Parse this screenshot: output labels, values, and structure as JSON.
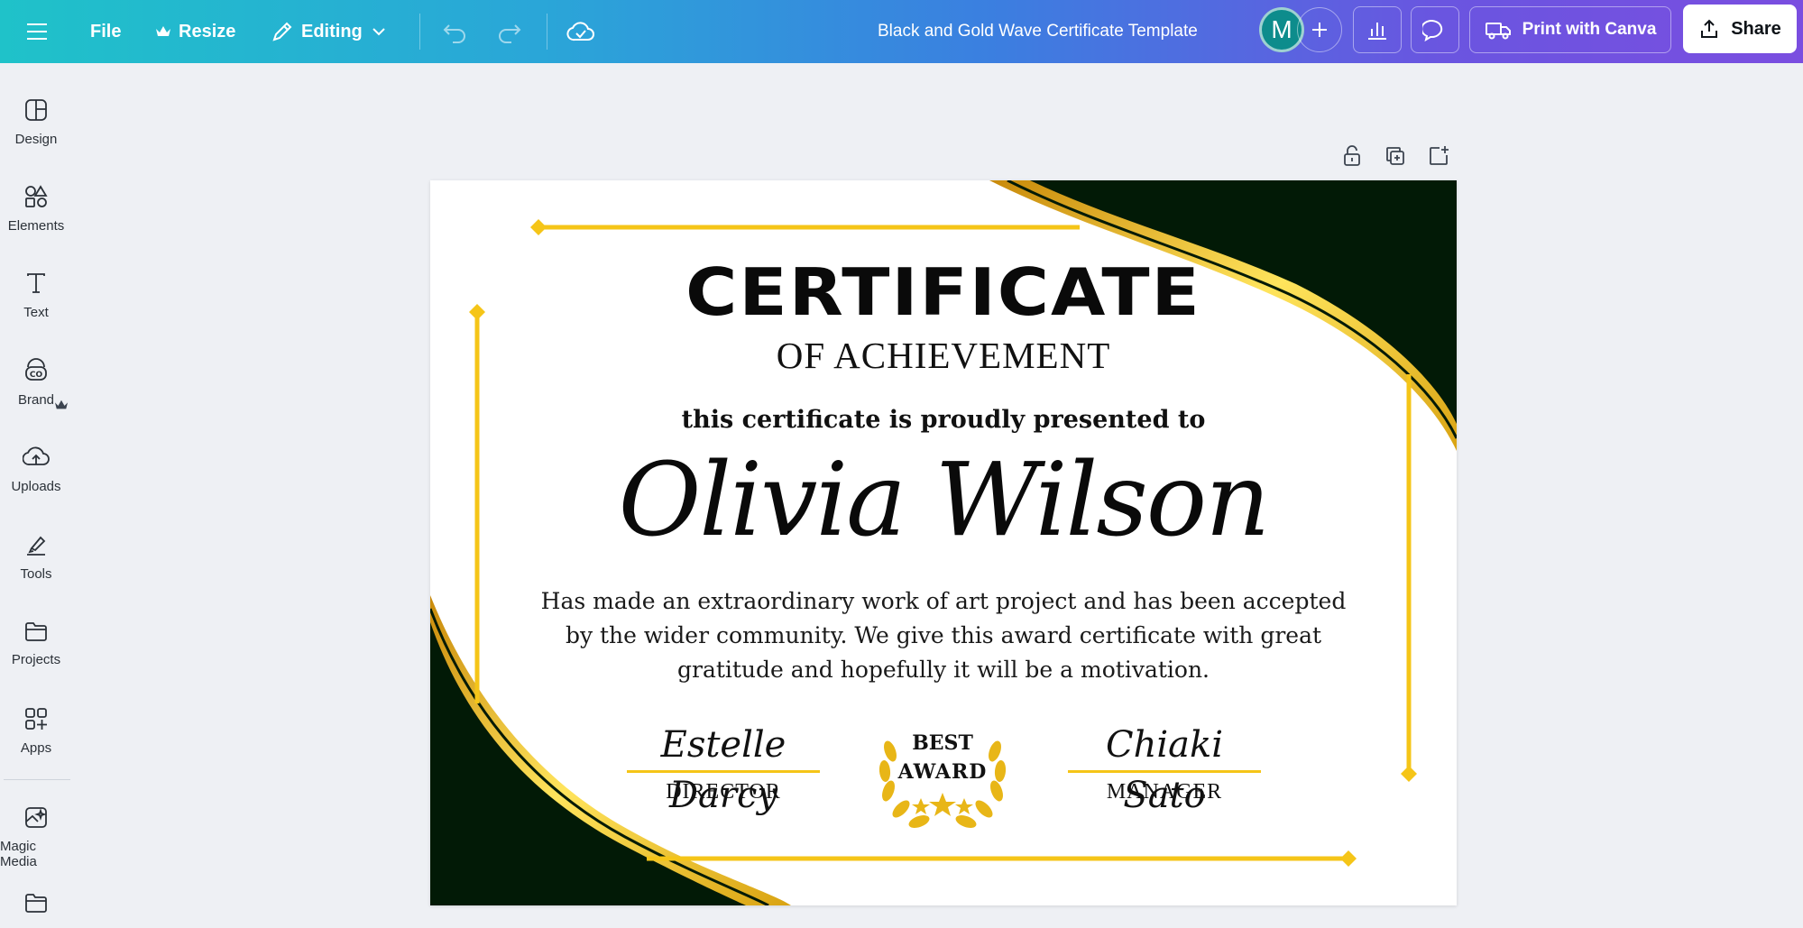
{
  "topbar": {
    "file_label": "File",
    "resize_label": "Resize",
    "editing_label": "Editing",
    "doc_title": "Black and Gold Wave Certificate Template",
    "avatar_initial": "M",
    "print_label": "Print with Canva",
    "share_label": "Share"
  },
  "sidebar": {
    "items": [
      {
        "label": "Design",
        "icon": "design-icon"
      },
      {
        "label": "Elements",
        "icon": "elements-icon"
      },
      {
        "label": "Text",
        "icon": "text-icon"
      },
      {
        "label": "Brand",
        "icon": "brand-icon"
      },
      {
        "label": "Uploads",
        "icon": "uploads-icon"
      },
      {
        "label": "Tools",
        "icon": "tools-icon"
      },
      {
        "label": "Projects",
        "icon": "projects-icon"
      },
      {
        "label": "Apps",
        "icon": "apps-icon"
      },
      {
        "label": "Magic Media",
        "icon": "magic-media-icon"
      }
    ]
  },
  "certificate": {
    "title": "CERTIFICATE",
    "subtitle": "OF ACHIEVEMENT",
    "presented": "this certificate is proudly presented to",
    "recipient": "Olivia Wilson",
    "body": "Has made an extraordinary work of art project and has been accepted by the wider community. We give this award certificate with great gratitude and hopefully it will be a motivation.",
    "signer_left_signature": "Estelle Darcy",
    "signer_left_role": "DIRECTOR",
    "signer_right_signature": "Chiaki Sato",
    "signer_right_role": "MANAGER",
    "award_line1": "BEST",
    "award_line2": "AWARD"
  },
  "colors": {
    "gold": "#f5c518",
    "dark_green": "#021a06",
    "accent_teal": "#1fc2c9",
    "accent_purple": "#7a4ee0"
  }
}
